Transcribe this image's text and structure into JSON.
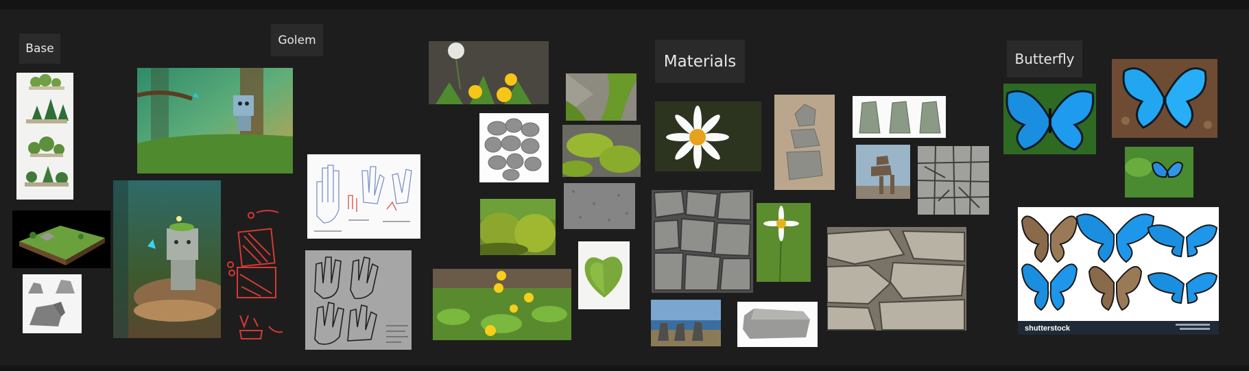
{
  "board": {
    "labels": {
      "base": "Base",
      "golem": "Golem",
      "materials": "Materials",
      "butterfly": "Butterfly"
    },
    "watermark": "shutterstock",
    "colors": {
      "background": "#1d1d1d",
      "label_bg": "#2a2a2a",
      "label_text": "#e8e8e8",
      "accent_butterfly": "#1a8fe0",
      "accent_moss": "#7aa83a",
      "sketch_red": "#d63a32"
    }
  }
}
